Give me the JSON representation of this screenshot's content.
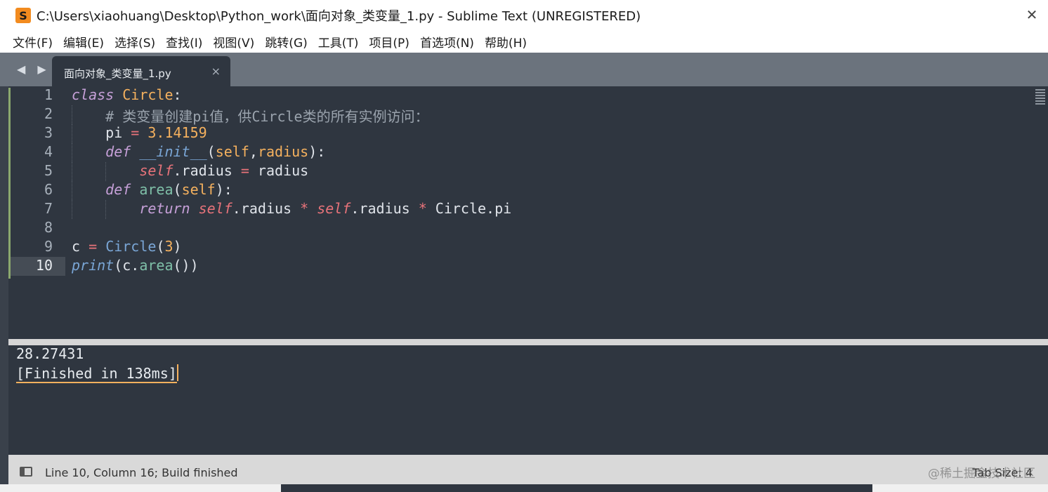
{
  "window": {
    "title": "C:\\Users\\xiaohuang\\Desktop\\Python_work\\面向对象_类变量_1.py - Sublime Text (UNREGISTERED)",
    "app_icon": "sublime-text-icon",
    "close_label": "✕"
  },
  "menu": {
    "items": [
      "文件(F)",
      "编辑(E)",
      "选择(S)",
      "查找(I)",
      "视图(V)",
      "跳转(G)",
      "工具(T)",
      "项目(P)",
      "首选项(N)",
      "帮助(H)"
    ]
  },
  "tabs": {
    "nav_label": "◀ ▶",
    "active": {
      "label": "面向对象_类变量_1.py",
      "close": "×"
    }
  },
  "editor": {
    "line_numbers": [
      "1",
      "2",
      "3",
      "4",
      "5",
      "6",
      "7",
      "8",
      "9",
      "10"
    ],
    "active_line": 10,
    "lines": [
      "class Circle:",
      "    # 类变量创建pi值，供Circle类的所有实例访问：",
      "    pi = 3.14159",
      "    def __init__(self,radius):",
      "        self.radius = radius",
      "    def area(self):",
      "        return self.radius * self.radius * Circle.pi",
      "",
      "c = Circle(3)",
      "print(c.area())"
    ]
  },
  "output": {
    "result": "28.27431",
    "finished": "[Finished in 138ms]"
  },
  "status": {
    "text": "Line 10, Column 16; Build finished",
    "tab_size": "Tab Size: 4",
    "watermark": "@稀土掘金技术社区"
  },
  "colors": {
    "background": "#2f3640",
    "keyword": "#c6a0d8",
    "class_name": "#f5b15e",
    "operator": "#e8737a",
    "function": "#7fc0a8",
    "builtin": "#7aa6d6",
    "cursor": "#f5b15e"
  }
}
